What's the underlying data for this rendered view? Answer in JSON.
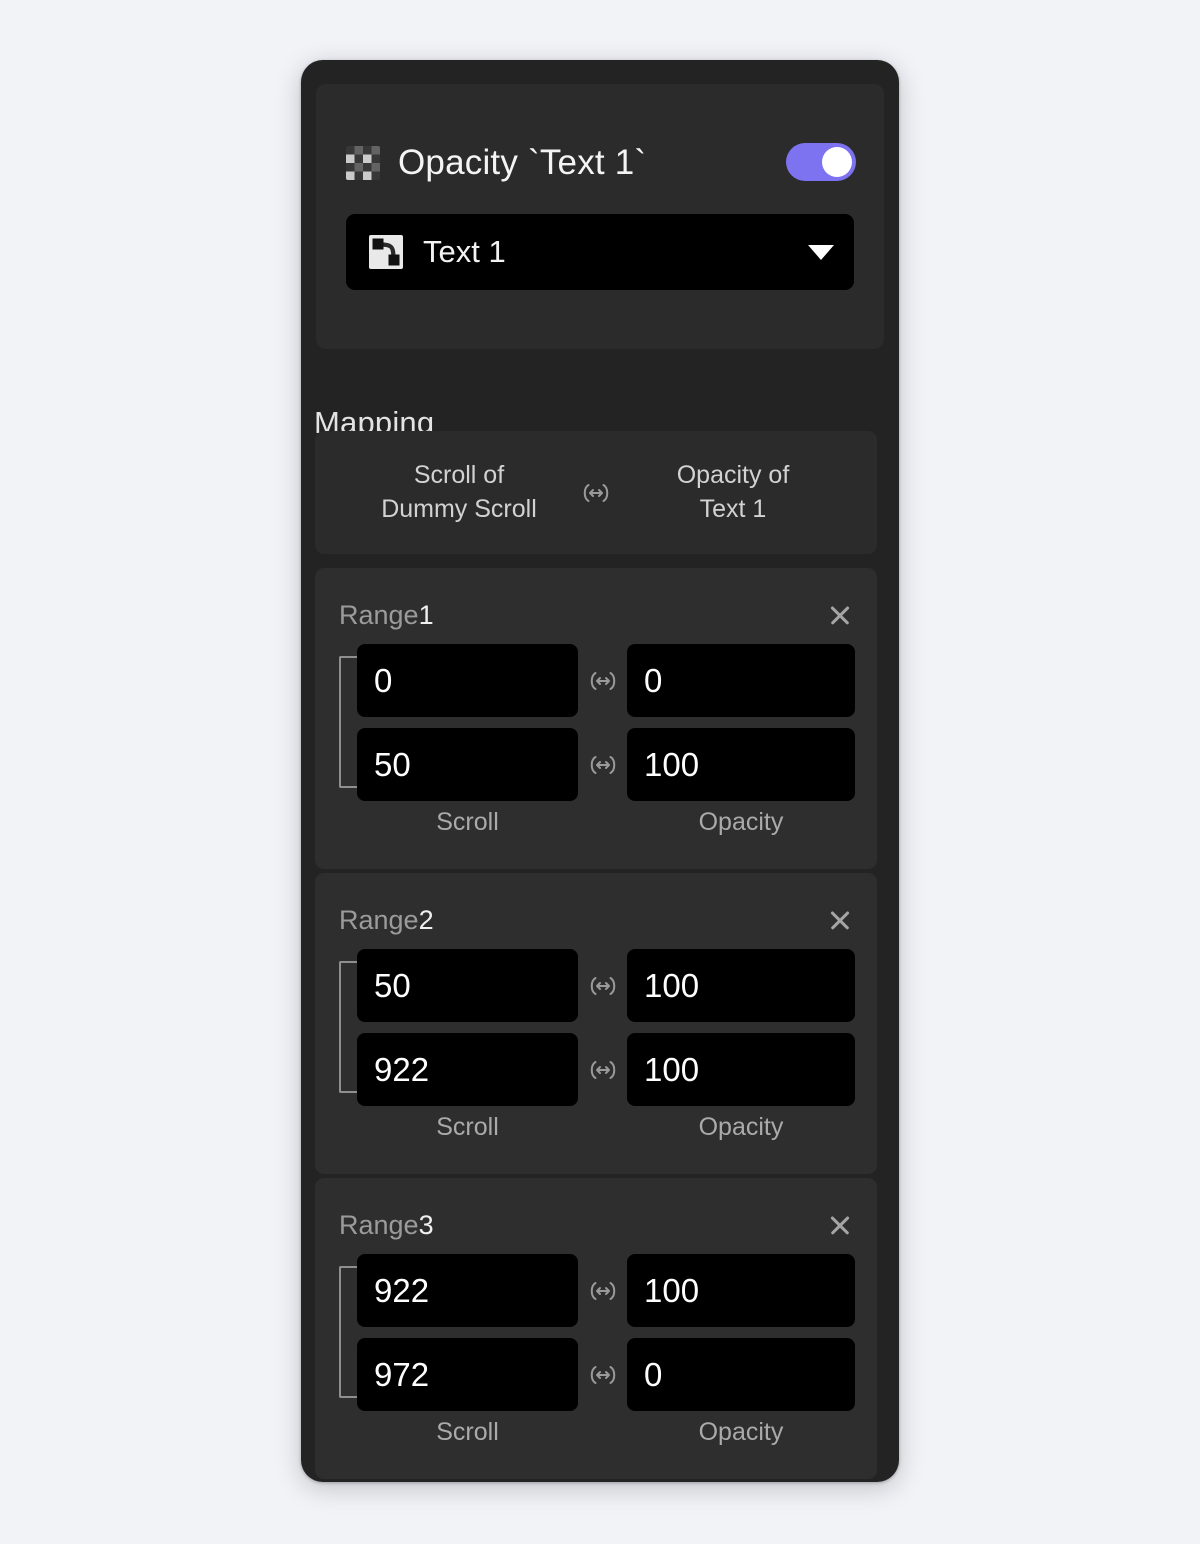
{
  "panel": {
    "header": {
      "icon": "checkerboard-opacity-icon",
      "title": "Opacity `Text 1`",
      "toggle_on": true,
      "toggle_color": "#7d72ef",
      "layer_select": {
        "icon": "vector-node-icon",
        "value": "Text 1",
        "caret": "chevron-down-icon"
      }
    },
    "mapping": {
      "heading": "Mapping",
      "source": "Scroll of\nDummy Scroll",
      "link_icon": "bidirectional-link-icon",
      "target": "Opacity of\nText 1"
    },
    "ranges": [
      {
        "label_prefix": "Range",
        "label_num": "1",
        "close": "close-icon",
        "from_source": "0",
        "from_target": "0",
        "to_source": "50",
        "to_target": "100",
        "source_axis": "Scroll",
        "target_axis": "Opacity"
      },
      {
        "label_prefix": "Range",
        "label_num": "2",
        "close": "close-icon",
        "from_source": "50",
        "from_target": "100",
        "to_source": "922",
        "to_target": "100",
        "source_axis": "Scroll",
        "target_axis": "Opacity"
      },
      {
        "label_prefix": "Range",
        "label_num": "3",
        "close": "close-icon",
        "from_source": "922",
        "from_target": "100",
        "to_source": "972",
        "to_target": "0",
        "source_axis": "Scroll",
        "target_axis": "Opacity"
      }
    ]
  },
  "colors": {
    "page_background": "#f2f3f7",
    "panel_background": "#232323",
    "card_background": "#2b2b2b",
    "range_card_background": "#2e2e2e",
    "input_background": "#000000",
    "accent": "#7d72ef",
    "text_primary": "#f2f2f2",
    "text_muted": "#aaaaaa"
  }
}
